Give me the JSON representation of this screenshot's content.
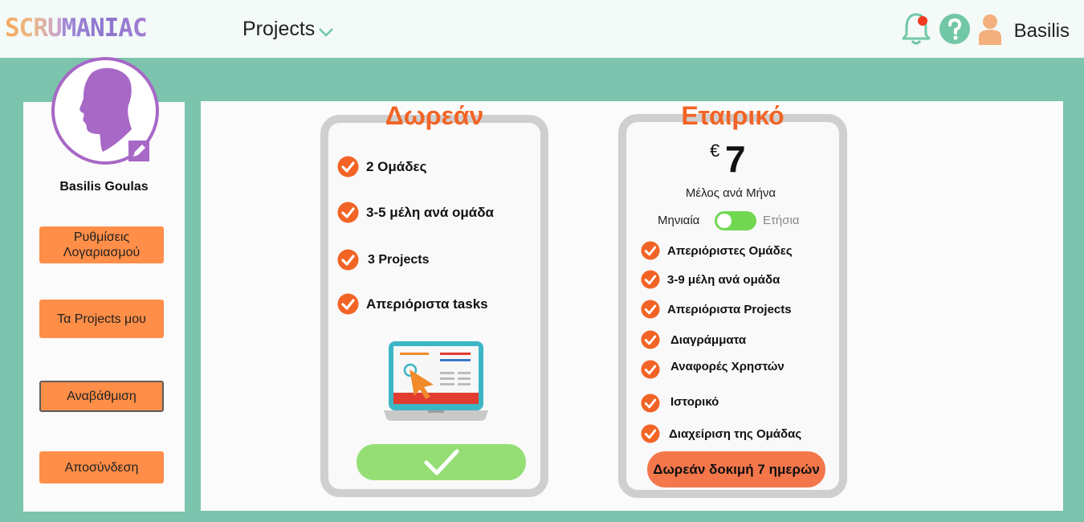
{
  "header": {
    "logo_part1": "SCRU",
    "logo_part2": "MANIAC",
    "projects_menu": "Projects",
    "username": "Basilis"
  },
  "sidebar": {
    "profile_name": "Basilis Goulas",
    "items": [
      {
        "label": "Ρυθμίσεις Λογαριασμού"
      },
      {
        "label": "Τα Projects μου"
      },
      {
        "label": "Αναβάθμιση",
        "active": true
      },
      {
        "label": "Αποσύνδεση"
      }
    ]
  },
  "plans": {
    "free": {
      "title": "Δωρεάν",
      "features": [
        "2 Ομάδες",
        "3-5 μέλη ανά ομάδα",
        "3 Projects",
        "Απεριόριστα tasks"
      ]
    },
    "business": {
      "title": "Εταιρικό",
      "currency": "€",
      "price": "7",
      "per": "Μέλος ανά Μήνα",
      "billing_monthly": "Μηνιαία",
      "billing_yearly": "Ετήσια",
      "features": [
        "Απεριόριστες Ομάδες",
        "3-9 μέλη ανά ομάδα",
        "Απεριόριστα Projects",
        "Διαγράμματα",
        "Αναφορές Χρηστών",
        "Ιστορικό",
        "Διαχείριση της Ομάδας"
      ],
      "trial_button": "Δωρεάν δοκιμή 7 ημερών"
    }
  },
  "colors": {
    "accent_orange": "#ff8e48",
    "title_orange": "#f26425",
    "background_teal": "#7cc4ad",
    "avatar_purple": "#a768c6",
    "toggle_green": "#72d852"
  },
  "icons": [
    "bell-icon",
    "help-icon",
    "user-icon",
    "chevron-down-icon",
    "check-icon",
    "edit-icon",
    "laptop-illustration"
  ]
}
